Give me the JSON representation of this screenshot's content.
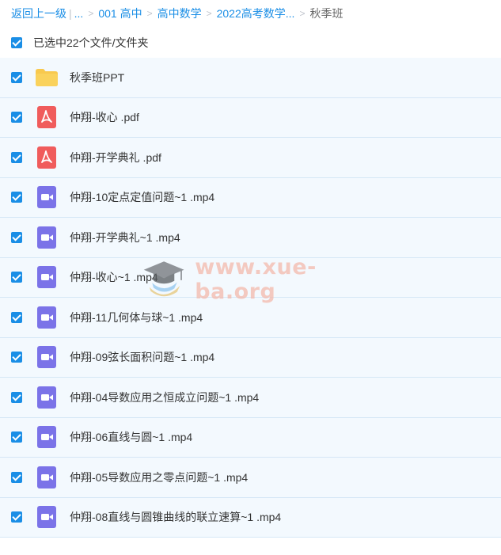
{
  "breadcrumb": {
    "back_label": "返回上一级",
    "ellipsis": "...",
    "crumbs": [
      "001 高中",
      "高中数学",
      "2022高考数学..."
    ],
    "current": "秋季班"
  },
  "selection": {
    "label": "已选中22个文件/文件夹"
  },
  "files": [
    {
      "name": "秋季班PPT",
      "icon": "folder-icon"
    },
    {
      "name": "仲翔-收心 .pdf",
      "icon": "pdf-icon"
    },
    {
      "name": "仲翔-开学典礼 .pdf",
      "icon": "pdf-icon"
    },
    {
      "name": "仲翔-10定点定值问题~1 .mp4",
      "icon": "video-icon"
    },
    {
      "name": "仲翔-开学典礼~1 .mp4",
      "icon": "video-icon"
    },
    {
      "name": "仲翔-收心~1 .mp4",
      "icon": "video-icon"
    },
    {
      "name": "仲翔-11几何体与球~1 .mp4",
      "icon": "video-icon"
    },
    {
      "name": "仲翔-09弦长面积问题~1 .mp4",
      "icon": "video-icon"
    },
    {
      "name": "仲翔-04导数应用之恒成立问题~1 .mp4",
      "icon": "video-icon"
    },
    {
      "name": "仲翔-06直线与圆~1 .mp4",
      "icon": "video-icon"
    },
    {
      "name": "仲翔-05导数应用之零点问题~1 .mp4",
      "icon": "video-icon"
    },
    {
      "name": "仲翔-08直线与圆锥曲线的联立速算~1 .mp4",
      "icon": "video-icon"
    }
  ],
  "watermark": {
    "text": "www.xue-ba.org"
  },
  "colors": {
    "link": "#1a8ee6",
    "row_bg": "#f3f9fe",
    "checkbox": "#1a8ee6",
    "folder": "#f8c94e",
    "pdf": "#f05c5c",
    "video": "#7b73e8"
  }
}
